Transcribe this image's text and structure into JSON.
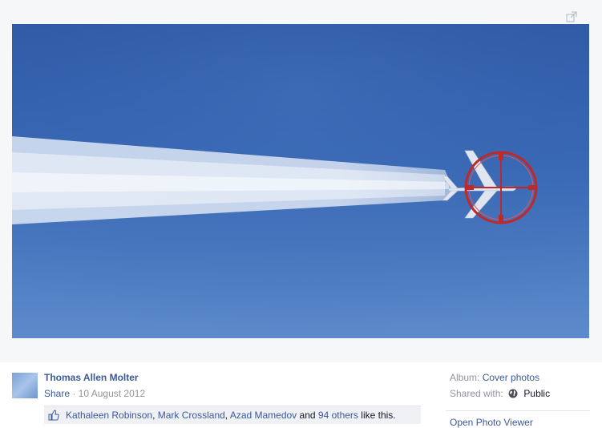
{
  "photo": {
    "owner_name": "Thomas Allen Molter",
    "share_label": "Share",
    "separator": " · ",
    "date": "10 August 2012"
  },
  "likes": {
    "people": [
      "Kathaleen Robinson",
      "Mark Crossland",
      "Azad Mamedov"
    ],
    "comma": ", ",
    "and": " and ",
    "others": "94 others",
    "suffix": " like this."
  },
  "sidebar": {
    "album_label": "Album:",
    "album_name": "Cover photos",
    "shared_label": "Shared with:",
    "privacy": "Public",
    "open_viewer": "Open Photo Viewer"
  },
  "icons": {
    "expand": "expand-icon",
    "like": "thumbs-up-icon",
    "privacy": "globe-icon"
  },
  "colors": {
    "link": "#3b5998",
    "muted": "#90949c",
    "sky": "#3a69b6",
    "crosshair": "#c0282a"
  }
}
